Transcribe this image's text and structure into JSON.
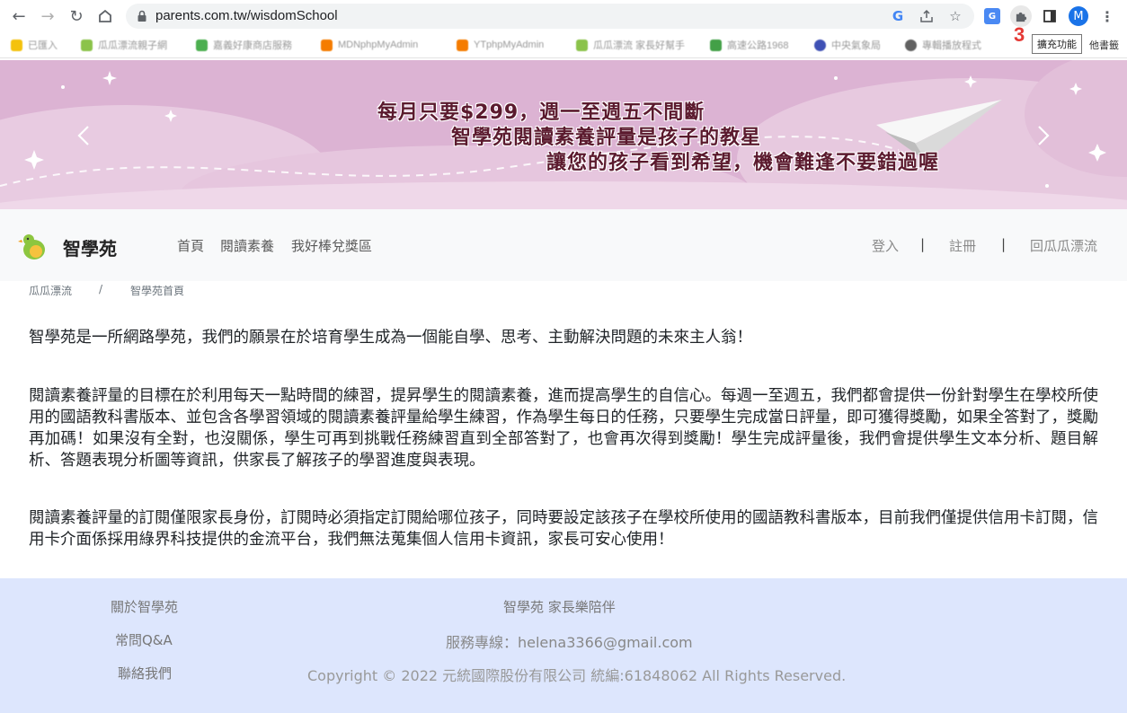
{
  "browser": {
    "url": "parents.com.tw/wisdomSchool",
    "tooltip": "擴充功能",
    "badge": "3",
    "profile_initial": "M"
  },
  "bookmarks": [
    {
      "label": "已匯入",
      "color": "#f4c20d"
    },
    {
      "label": "瓜瓜漂流親子網",
      "color": "#8bc34a"
    },
    {
      "label": "嘉義好康商店服務",
      "color": "#4caf50"
    },
    {
      "label": "MDNphpMyAdmin",
      "color": "#f57c00"
    },
    {
      "label": "YTphpMyAdmin",
      "color": "#f57c00"
    },
    {
      "label": "瓜瓜漂流 家長好幫手",
      "color": "#8bc34a"
    },
    {
      "label": "高速公路1968",
      "color": "#43a047"
    },
    {
      "label": "中央氣象局",
      "color": "#3f51b5"
    },
    {
      "label": "專輯播放程式",
      "color": "#616161"
    }
  ],
  "bookmarks_other": "他書籤",
  "banner": {
    "line1": "每月只要$299，週一至週五不間斷",
    "line2": "智學苑閱讀素養評量是孩子的教星",
    "line3": "讓您的孩子看到希望，機會難逢不要錯過喔",
    "bg_color": "#dcb3d3"
  },
  "site": {
    "brand": "智學苑",
    "nav": [
      "首頁",
      "閱讀素養",
      "我好棒兌獎區"
    ],
    "login": "登入",
    "register": "註冊",
    "back": "回瓜瓜漂流",
    "sep": "|"
  },
  "breadcrumb": {
    "home": "瓜瓜漂流",
    "sep": "/",
    "current": "智學苑首頁"
  },
  "content": {
    "p1": "智學苑是一所網路學苑，我們的願景在於培育學生成為一個能自學、思考、主動解決問題的未來主人翁！",
    "p2": "閱讀素養評量的目標在於利用每天一點時間的練習，提昇學生的閱讀素養，進而提高學生的自信心。每週一至週五，我們都會提供一份針對學生在學校所使用的國語教科書版本、並包含各學習領域的閱讀素養評量給學生練習，作為學生每日的任務，只要學生完成當日評量，即可獲得獎勵，如果全答對了，獎勵再加碼！如果沒有全對，也沒關係，學生可再到挑戰任務練習直到全部答對了，也會再次得到獎勵！學生完成評量後，我們會提供學生文本分析、題目解析、答題表現分析圖等資訊，供家長了解孩子的學習進度與表現。",
    "p3": "閱讀素養評量的訂閱僅限家長身份，訂閱時必須指定訂閱給哪位孩子，同時要設定該孩子在學校所使用的國語教科書版本，目前我們僅提供信用卡訂閱，信用卡介面係採用綠界科技提供的金流平台，我們無法蒐集個人信用卡資訊，家長可安心使用！"
  },
  "footer": {
    "about": "關於智學苑",
    "faq": "常問Q&A",
    "contact": "聯絡我們",
    "slogan": "智學苑  家長樂陪伴",
    "service": "服務專線：helena3366@gmail.com",
    "copyright": "Copyright © 2022 元統國際股份有限公司 統編:61848062  All Rights Reserved.",
    "bg_color": "#dde6fd"
  }
}
